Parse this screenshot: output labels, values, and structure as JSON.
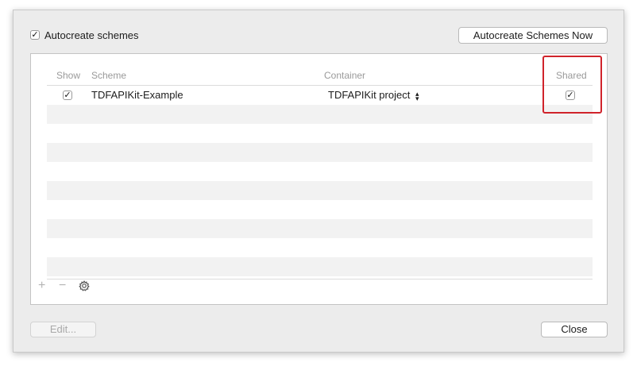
{
  "top": {
    "autocreate_checkbox": {
      "checked": true,
      "label": "Autocreate schemes"
    },
    "autocreate_now_button": "Autocreate Schemes Now"
  },
  "table": {
    "columns": [
      "Show",
      "Scheme",
      "Container",
      "Shared"
    ],
    "rows": [
      {
        "show": true,
        "scheme": "TDFAPIKit-Example",
        "container": "TDFAPIKit project",
        "shared": true
      }
    ]
  },
  "toolbar": {
    "add_glyph": "+",
    "remove_glyph": "−",
    "settings_icon": "gear-icon"
  },
  "buttons": {
    "edit": "Edit...",
    "close": "Close"
  },
  "glyphs": {
    "check": "✓",
    "stepper": "⌃⌄"
  },
  "colors": {
    "highlight": "#d0232b"
  }
}
